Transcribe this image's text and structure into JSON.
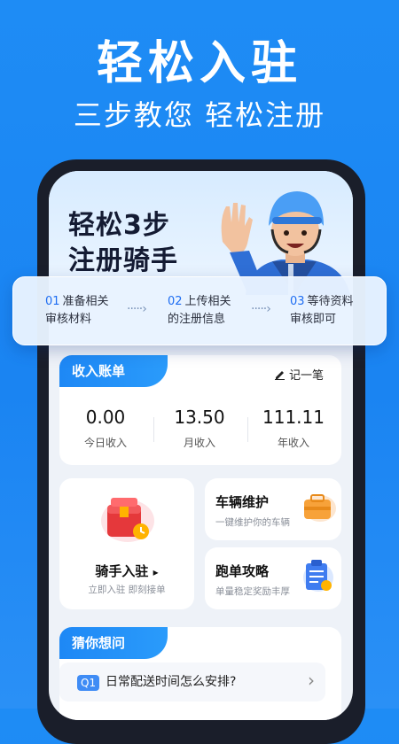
{
  "hero": {
    "title": "轻松入驻",
    "subtitle": "三步教您 轻松注册"
  },
  "promo": {
    "line1": "轻松3步",
    "line2": "注册骑手"
  },
  "steps": [
    {
      "num": "01",
      "line1": "准备相关",
      "line2": "审核材料"
    },
    {
      "num": "02",
      "line1": "上传相关",
      "line2": "的注册信息"
    },
    {
      "num": "03",
      "line1": "等待资料",
      "line2": "审核即可"
    }
  ],
  "step_arrow": "·····›",
  "income": {
    "tab_label": "收入账单",
    "record_label": "记一笔",
    "stats": [
      {
        "value": "0.00",
        "label": "今日收入"
      },
      {
        "value": "13.50",
        "label": "月收入"
      },
      {
        "value": "111.11",
        "label": "年收入"
      }
    ]
  },
  "features": {
    "join": {
      "title": "骑手入驻",
      "arrow": "▸",
      "subtitle": "立即入驻 即刻接单"
    },
    "vehicle": {
      "title": "车辆维护",
      "subtitle": "一键维护你的车辆"
    },
    "strategy": {
      "title": "跑单攻略",
      "subtitle": "单量稳定奖励丰厚"
    }
  },
  "faq": {
    "tab_label": "猜你想问",
    "items": [
      {
        "badge": "Q1",
        "question": "日常配送时间怎么安排?",
        "chevron": "›"
      }
    ]
  },
  "colors": {
    "brand_blue": "#1e88f5",
    "background_blue": "#1a84f2",
    "text_dark": "#141b33"
  }
}
